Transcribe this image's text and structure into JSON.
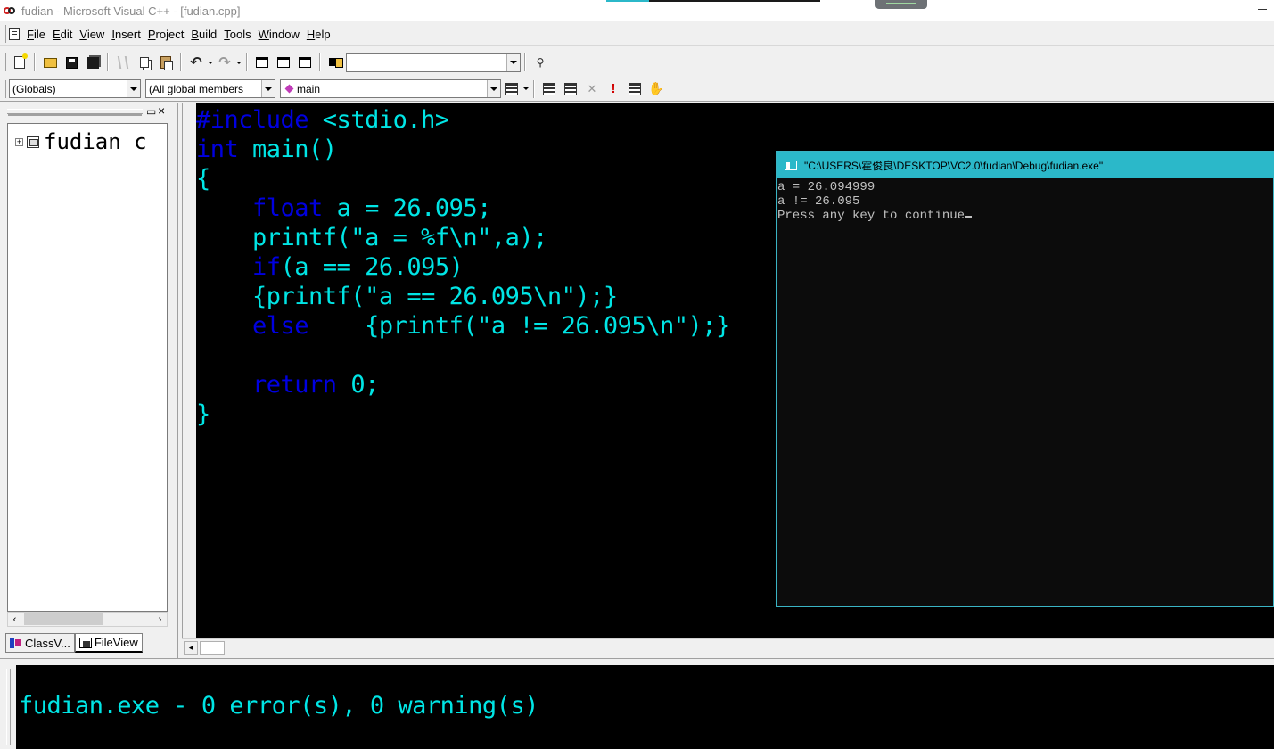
{
  "window": {
    "title": "fudian - Microsoft Visual C++ - [fudian.cpp]"
  },
  "menu": {
    "items": [
      {
        "accel": "F",
        "rest": "ile"
      },
      {
        "accel": "E",
        "rest": "dit"
      },
      {
        "accel": "V",
        "rest": "iew"
      },
      {
        "accel": "I",
        "rest": "nsert"
      },
      {
        "accel": "P",
        "rest": "roject"
      },
      {
        "accel": "B",
        "rest": "uild"
      },
      {
        "accel": "T",
        "rest": "ools"
      },
      {
        "accel": "W",
        "rest": "indow"
      },
      {
        "accel": "H",
        "rest": "elp"
      }
    ]
  },
  "toolbar": {
    "find_combo_value": "",
    "scope_combo": "(Globals)",
    "members_combo": "(All global members",
    "function_combo": "main"
  },
  "workspace": {
    "tree_root": "fudian c",
    "tabs": [
      {
        "label": "ClassV..."
      },
      {
        "label": "FileView"
      }
    ]
  },
  "editor": {
    "filename": "fudian.cpp",
    "lines": [
      "#include <stdio.h>",
      "int main()",
      "{",
      "    float a = 26.095;",
      "    printf(\"a = %f\\n\",a);",
      "    if(a == 26.095)",
      "    {printf(\"a == 26.095\\n\");}",
      "    else    {printf(\"a != 26.095\\n\");}",
      "",
      "    return 0;",
      "}"
    ]
  },
  "console": {
    "title": "\"C:\\USERS\\霍俊良\\DESKTOP\\VC2.0\\fudian\\Debug\\fudian.exe\"",
    "lines": [
      "a = 26.094999",
      "a != 26.095",
      "Press any key to continue"
    ]
  },
  "output": {
    "text": "fudian.exe - 0 error(s), 0 warning(s)"
  },
  "colors": {
    "code_text": "#00e5e5",
    "keyword": "#0000e0",
    "editor_bg": "#000000",
    "console_titlebar": "#2bb8c9"
  }
}
